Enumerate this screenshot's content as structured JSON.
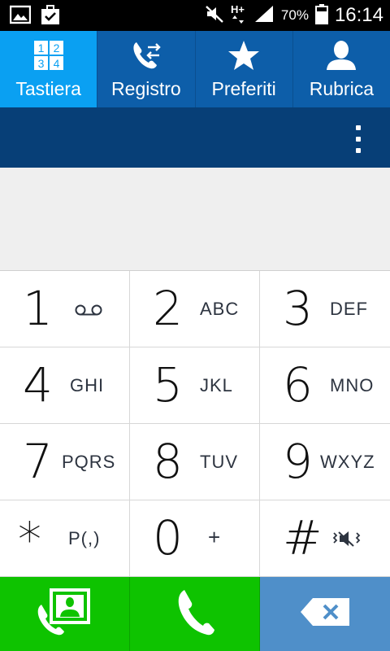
{
  "status_bar": {
    "battery_percent": "70%",
    "time": "16:14",
    "network": "H+"
  },
  "tabs": [
    {
      "label": "Tastiera",
      "active": true
    },
    {
      "label": "Registro",
      "active": false
    },
    {
      "label": "Preferiti",
      "active": false
    },
    {
      "label": "Rubrica",
      "active": false
    }
  ],
  "keypad_icon_digits": [
    "1",
    "2",
    "3",
    "4"
  ],
  "keypad": [
    {
      "digit": "1",
      "letters": ""
    },
    {
      "digit": "2",
      "letters": "ABC"
    },
    {
      "digit": "3",
      "letters": "DEF"
    },
    {
      "digit": "4",
      "letters": "GHI"
    },
    {
      "digit": "5",
      "letters": "JKL"
    },
    {
      "digit": "6",
      "letters": "MNO"
    },
    {
      "digit": "7",
      "letters": "PQRS"
    },
    {
      "digit": "8",
      "letters": "TUV"
    },
    {
      "digit": "9",
      "letters": "WXYZ"
    },
    {
      "digit": "*",
      "letters": "P(,)"
    },
    {
      "digit": "0",
      "letters": "+"
    },
    {
      "digit": "#",
      "letters": ""
    }
  ],
  "display": {
    "value": ""
  },
  "colors": {
    "tab_bar": "#0d5ea9",
    "tab_active": "#0aa0f2",
    "action_bar": "#073f77",
    "call_green": "#0ec300",
    "delete_blue": "#4f8fc9"
  }
}
